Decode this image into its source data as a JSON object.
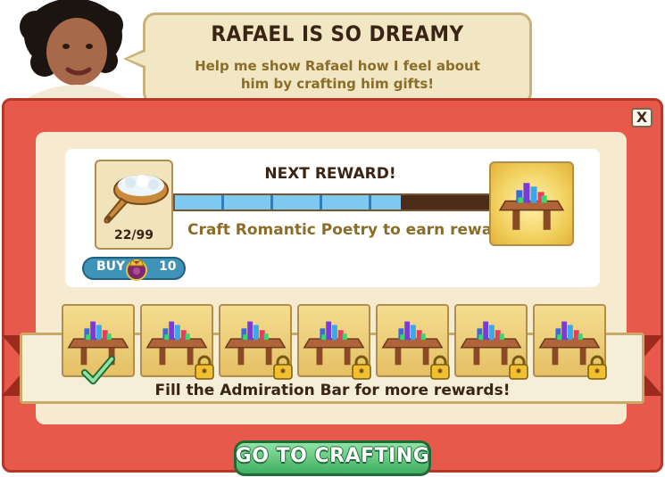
{
  "quest": {
    "title": "RAFAEL IS SO DREAMY",
    "description": "Help me show Rafael how I feel about him by crafting him gifts!"
  },
  "close_label": "X",
  "reward": {
    "heading": "NEXT REWARD!",
    "progress_fraction": 0.72,
    "message": "Craft Romantic Poetry to earn rewards."
  },
  "item": {
    "name": "brush-icon",
    "count": "22/99"
  },
  "buy": {
    "label": "BUY",
    "cost": "10",
    "currency_icon": "crown-coin-icon"
  },
  "tiers": [
    {
      "icon": "gem-table-icon",
      "state": "completed"
    },
    {
      "icon": "gem-table-icon",
      "state": "locked"
    },
    {
      "icon": "gem-table-icon",
      "state": "locked"
    },
    {
      "icon": "gem-table-icon",
      "state": "locked"
    },
    {
      "icon": "gem-table-icon",
      "state": "locked"
    },
    {
      "icon": "gem-table-icon",
      "state": "locked"
    },
    {
      "icon": "gem-table-icon",
      "state": "locked"
    }
  ],
  "fill_message": "Fill the Admiration Bar for more rewards!",
  "cta_label": "GO TO CRAFTING",
  "colors": {
    "panel": "#e75a4b",
    "accent_blue": "#3f93b9",
    "cta_green": "#3fae60"
  }
}
